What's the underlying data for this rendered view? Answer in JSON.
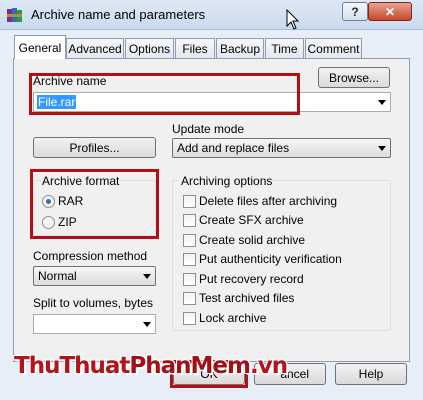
{
  "window": {
    "title": "Archive name and parameters",
    "help_label": "?",
    "close_label": "✕"
  },
  "tabs": [
    {
      "label": "General",
      "active": true
    },
    {
      "label": "Advanced",
      "active": false
    },
    {
      "label": "Options",
      "active": false
    },
    {
      "label": "Files",
      "active": false
    },
    {
      "label": "Backup",
      "active": false
    },
    {
      "label": "Time",
      "active": false
    },
    {
      "label": "Comment",
      "active": false
    }
  ],
  "general": {
    "archive_name_label": "Archive name",
    "archive_name_value": "File.rar",
    "browse_label": "Browse...",
    "profiles_label": "Profiles...",
    "update_mode_label": "Update mode",
    "update_mode_value": "Add and replace files",
    "archive_format_label": "Archive format",
    "format_options": [
      {
        "label": "RAR",
        "selected": true
      },
      {
        "label": "ZIP",
        "selected": false
      }
    ],
    "compression_label": "Compression method",
    "compression_value": "Normal",
    "split_label": "Split to volumes, bytes",
    "split_value": "",
    "archiving_options_label": "Archiving options",
    "archiving_options": [
      {
        "label": "Delete files after archiving",
        "checked": false
      },
      {
        "label": "Create SFX archive",
        "checked": false
      },
      {
        "label": "Create solid archive",
        "checked": false
      },
      {
        "label": "Put authenticity verification",
        "checked": false
      },
      {
        "label": "Put recovery record",
        "checked": false
      },
      {
        "label": "Test archived files",
        "checked": false
      },
      {
        "label": "Lock archive",
        "checked": false
      }
    ]
  },
  "footer": {
    "ok_label": "OK",
    "cancel_label": "ancel",
    "help_label": "Help"
  },
  "watermark": {
    "part1": "ThuThuat",
    "part2": "PhanMem",
    "part3": ".vn"
  },
  "colors": {
    "highlight_box": "#b30f17",
    "selection": "#3399ff",
    "watermark": "#b2141d"
  },
  "icons": {
    "app": "winrar-books-icon",
    "cursor": "mouse-pointer-icon"
  }
}
